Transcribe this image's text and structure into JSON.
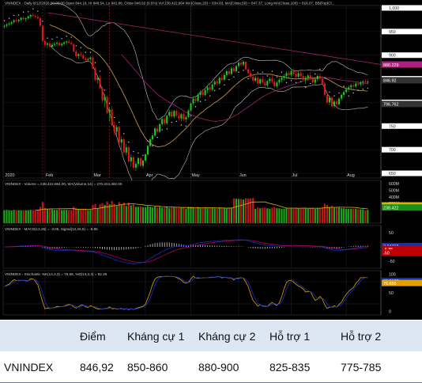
{
  "chart_data": {
    "type": "candlestick",
    "symbol": "VNINDEX",
    "header": "VNINDEX - Daily 8/12/2020 00:00:00 Open 844.19, Hi 848.54, Lo 842.88, Close 846.92 (0.5%) Vol 238,422,864 MA(Close,20) = 834.83, MA(Close,50) = 847.37, Long MA(Close,100) = 818.07, BB(Top(Cl...",
    "price_ticks": [
      "1,000",
      "950",
      "900",
      "850",
      "800",
      "750",
      "700",
      "650"
    ],
    "price_tick_values": [
      1000,
      950,
      900,
      850,
      800,
      750,
      700,
      650
    ],
    "price_ylim": [
      640,
      1005
    ],
    "price_labels": [
      {
        "text": "880.229",
        "value": 880.2,
        "color": "#b0207f"
      },
      {
        "text": "846.92",
        "value": 846.9,
        "color": "#333333"
      },
      {
        "text": "796.762",
        "value": 796.8,
        "color": "#333333"
      }
    ],
    "months": [
      "2020",
      "Feb",
      "Mar",
      "Apr",
      "May",
      "Jun",
      "Jul",
      "Aug"
    ],
    "month_days": [
      0,
      17,
      37,
      59,
      78,
      98,
      120,
      143
    ],
    "num_days": 158,
    "ohlc": [
      [
        960,
        965,
        956,
        962
      ],
      [
        962,
        968,
        958,
        965
      ],
      [
        965,
        970,
        961,
        967
      ],
      [
        967,
        972,
        964,
        970
      ],
      [
        970,
        976,
        966,
        974
      ],
      [
        974,
        978,
        969,
        972
      ],
      [
        972,
        977,
        968,
        975
      ],
      [
        975,
        981,
        972,
        979
      ],
      [
        979,
        983,
        974,
        976
      ],
      [
        976,
        980,
        971,
        978
      ],
      [
        978,
        984,
        975,
        982
      ],
      [
        982,
        988,
        978,
        985
      ],
      [
        985,
        990,
        980,
        983
      ],
      [
        983,
        987,
        978,
        981
      ],
      [
        981,
        985,
        975,
        978
      ],
      [
        978,
        981,
        960,
        962
      ],
      [
        962,
        964,
        925,
        930
      ],
      [
        930,
        935,
        918,
        922
      ],
      [
        922,
        928,
        915,
        925
      ],
      [
        925,
        930,
        915,
        918
      ],
      [
        918,
        926,
        914,
        922
      ],
      [
        922,
        928,
        918,
        924
      ],
      [
        924,
        930,
        920,
        926
      ],
      [
        926,
        931,
        919,
        921
      ],
      [
        921,
        927,
        917,
        924
      ],
      [
        924,
        930,
        920,
        927
      ],
      [
        927,
        932,
        922,
        929
      ],
      [
        929,
        934,
        924,
        926
      ],
      [
        926,
        930,
        920,
        923
      ],
      [
        923,
        926,
        905,
        908
      ],
      [
        908,
        912,
        895,
        898
      ],
      [
        898,
        905,
        892,
        902
      ],
      [
        902,
        908,
        896,
        900
      ],
      [
        900,
        904,
        890,
        893
      ],
      [
        893,
        898,
        885,
        890
      ],
      [
        890,
        895,
        886,
        892
      ],
      [
        892,
        898,
        888,
        895
      ],
      [
        895,
        898,
        870,
        872
      ],
      [
        872,
        876,
        845,
        848
      ],
      [
        848,
        856,
        840,
        852
      ],
      [
        852,
        858,
        828,
        830
      ],
      [
        830,
        834,
        800,
        805
      ],
      [
        805,
        818,
        790,
        812
      ],
      [
        812,
        815,
        775,
        778
      ],
      [
        778,
        790,
        760,
        785
      ],
      [
        785,
        792,
        750,
        752
      ],
      [
        752,
        760,
        730,
        738
      ],
      [
        738,
        752,
        728,
        748
      ],
      [
        748,
        750,
        712,
        715
      ],
      [
        715,
        728,
        700,
        722
      ],
      [
        722,
        726,
        690,
        694
      ],
      [
        694,
        712,
        688,
        705
      ],
      [
        705,
        708,
        672,
        675
      ],
      [
        675,
        690,
        664,
        684
      ],
      [
        684,
        688,
        658,
        662
      ],
      [
        662,
        676,
        655,
        670
      ],
      [
        670,
        685,
        664,
        682
      ],
      [
        682,
        684,
        662,
        666
      ],
      [
        666,
        680,
        660,
        677
      ],
      [
        677,
        692,
        672,
        690
      ],
      [
        690,
        710,
        686,
        708
      ],
      [
        708,
        726,
        704,
        722
      ],
      [
        722,
        735,
        716,
        730
      ],
      [
        730,
        748,
        726,
        745
      ],
      [
        745,
        752,
        734,
        738
      ],
      [
        738,
        756,
        735,
        754
      ],
      [
        754,
        768,
        750,
        765
      ],
      [
        765,
        770,
        752,
        756
      ],
      [
        756,
        774,
        752,
        772
      ],
      [
        772,
        785,
        768,
        780
      ],
      [
        780,
        784,
        766,
        770
      ],
      [
        770,
        784,
        766,
        782
      ],
      [
        782,
        786,
        768,
        772
      ],
      [
        772,
        780,
        762,
        766
      ],
      [
        766,
        778,
        760,
        775
      ],
      [
        775,
        780,
        760,
        764
      ],
      [
        764,
        772,
        758,
        769
      ],
      [
        769,
        786,
        766,
        783
      ],
      [
        783,
        800,
        780,
        798
      ],
      [
        798,
        812,
        794,
        808
      ],
      [
        808,
        815,
        799,
        803
      ],
      [
        803,
        820,
        800,
        816
      ],
      [
        816,
        826,
        810,
        822
      ],
      [
        822,
        828,
        812,
        816
      ],
      [
        816,
        830,
        813,
        826
      ],
      [
        826,
        836,
        820,
        832
      ],
      [
        832,
        838,
        822,
        827
      ],
      [
        827,
        842,
        824,
        838
      ],
      [
        838,
        848,
        833,
        844
      ],
      [
        844,
        850,
        836,
        840
      ],
      [
        840,
        855,
        837,
        852
      ],
      [
        852,
        860,
        844,
        848
      ],
      [
        848,
        862,
        845,
        858
      ],
      [
        858,
        870,
        854,
        866
      ],
      [
        866,
        874,
        856,
        860
      ],
      [
        860,
        876,
        858,
        872
      ],
      [
        872,
        880,
        862,
        866
      ],
      [
        866,
        880,
        863,
        877
      ],
      [
        877,
        888,
        872,
        884
      ],
      [
        884,
        892,
        876,
        880
      ],
      [
        880,
        890,
        876,
        886
      ],
      [
        886,
        887,
        868,
        870
      ],
      [
        870,
        876,
        858,
        862
      ],
      [
        862,
        868,
        850,
        854
      ],
      [
        854,
        860,
        840,
        846
      ],
      [
        846,
        856,
        842,
        852
      ],
      [
        852,
        855,
        836,
        840
      ],
      [
        840,
        852,
        836,
        849
      ],
      [
        849,
        856,
        838,
        842
      ],
      [
        842,
        850,
        832,
        836
      ],
      [
        836,
        848,
        832,
        845
      ],
      [
        845,
        854,
        840,
        850
      ],
      [
        850,
        858,
        840,
        844
      ],
      [
        844,
        850,
        830,
        834
      ],
      [
        834,
        846,
        830,
        842
      ],
      [
        842,
        852,
        836,
        848
      ],
      [
        848,
        856,
        842,
        852
      ],
      [
        852,
        860,
        846,
        856
      ],
      [
        856,
        866,
        850,
        862
      ],
      [
        862,
        868,
        852,
        858
      ],
      [
        858,
        870,
        854,
        866
      ],
      [
        866,
        872,
        856,
        860
      ],
      [
        860,
        868,
        850,
        854
      ],
      [
        854,
        866,
        850,
        862
      ],
      [
        862,
        868,
        852,
        856
      ],
      [
        856,
        862,
        844,
        848
      ],
      [
        848,
        856,
        840,
        852
      ],
      [
        852,
        860,
        846,
        857
      ],
      [
        857,
        864,
        848,
        852
      ],
      [
        852,
        856,
        838,
        842
      ],
      [
        842,
        852,
        838,
        849
      ],
      [
        849,
        860,
        844,
        856
      ],
      [
        856,
        862,
        846,
        850
      ],
      [
        850,
        856,
        836,
        840
      ],
      [
        840,
        844,
        812,
        816
      ],
      [
        816,
        824,
        796,
        800
      ],
      [
        800,
        814,
        794,
        810
      ],
      [
        810,
        812,
        788,
        792
      ],
      [
        792,
        806,
        788,
        802
      ],
      [
        802,
        808,
        790,
        796
      ],
      [
        796,
        812,
        793,
        808
      ],
      [
        808,
        820,
        804,
        816
      ],
      [
        816,
        826,
        810,
        822
      ],
      [
        822,
        832,
        818,
        828
      ],
      [
        828,
        836,
        822,
        832
      ],
      [
        832,
        840,
        826,
        836
      ],
      [
        836,
        842,
        828,
        834
      ],
      [
        834,
        844,
        830,
        840
      ],
      [
        840,
        846,
        834,
        838
      ],
      [
        838,
        846,
        834,
        842
      ],
      [
        842,
        848,
        836,
        844
      ],
      [
        844,
        849,
        840,
        842
      ],
      [
        842,
        848,
        838,
        844
      ]
    ],
    "volume_ticks": [
      "600M",
      "500M",
      "400M",
      "300M"
    ],
    "volume_tick_values": [
      600,
      500,
      400,
      300
    ],
    "volume_ylim": [
      0,
      650
    ],
    "volume_labels": [
      {
        "text": "270.223",
        "value": 270.2,
        "color": "#e0b400"
      },
      {
        "text": "238.422",
        "value": 238.4,
        "color": "#1a8f1a"
      }
    ],
    "volume_header": "VNINDEX - Volume = 238,422,864.00, MA(Volume,14) = 270,223,392.00",
    "macd_header": "VNINDEX - MACD(12,26) = -3.05, Signal(12,26,9) = -6.85",
    "macd_ticks": [
      "50",
      "-50"
    ],
    "macd_tick_values": [
      50,
      -50
    ],
    "macd_ylim": [
      -75,
      75
    ],
    "macd_labels": [
      {
        "text": "3.04718",
        "value": 3.0,
        "color": "#1030c0"
      },
      {
        "text": "-6.85",
        "value": -6.85,
        "color": "#c00000"
      },
      {
        "text": "-50",
        "value": -20,
        "color": "#c00000"
      }
    ],
    "stoch_header": "VNINDEX - Stochastic %K(14,3,3) = 76.66, %D(14,3,3) = 82.26",
    "stoch_ticks": [
      "100",
      "50",
      "0"
    ],
    "stoch_tick_values": [
      100,
      50,
      0
    ],
    "stoch_ylim": [
      -10,
      110
    ],
    "stoch_labels": [
      {
        "text": "82.2627",
        "value": 82.26,
        "color": "#1030c0"
      },
      {
        "text": "76.656",
        "value": 76.66,
        "color": "#e0a000"
      }
    ],
    "colors": {
      "up": "#21c621",
      "down": "#e01818",
      "ma_short": "#c8a24a",
      "ma_long": "#a3256c",
      "bb": "#bfbfbf",
      "volume_ma": "#e0b400",
      "macd": "#1030c0",
      "signal": "#b00060",
      "stoch_k": "#e0a000",
      "stoch_d": "#1a34c8",
      "dashed_line": "#b31b1b"
    }
  },
  "table": {
    "headers": [
      "",
      "Điểm",
      "Kháng cự 1",
      "Kháng cự 2",
      "Hỗ trợ 1",
      "Hỗ trợ 2"
    ],
    "rows": [
      [
        "VNINDEX",
        "846,92",
        "850-860",
        "880-900",
        "825-835",
        "775-785"
      ]
    ]
  }
}
